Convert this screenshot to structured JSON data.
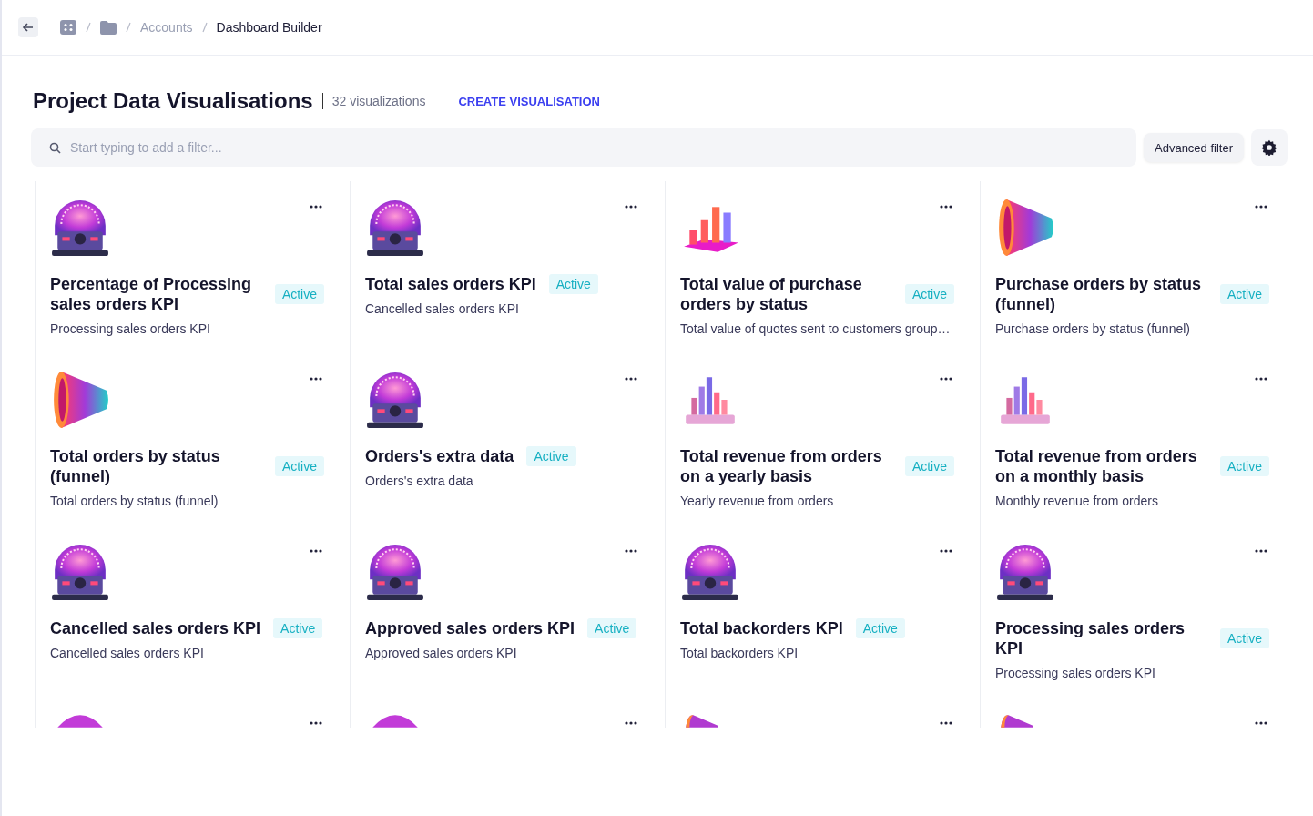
{
  "breadcrumb": {
    "items": [
      "Accounts",
      "Dashboard Builder"
    ]
  },
  "header": {
    "title": "Project Data Visualisations",
    "count": "32 visualizations",
    "create_link": "CREATE VISUALISATION"
  },
  "search": {
    "placeholder": "Start typing to add a filter...",
    "advanced_filter": "Advanced filter"
  },
  "cards": [
    {
      "kind": "gauge",
      "title": "Percentage of Processing sales orders KPI",
      "status": "Active",
      "description": "Processing sales orders KPI"
    },
    {
      "kind": "gauge",
      "title": "Total sales orders KPI",
      "status": "Active",
      "description": "Cancelled sales orders KPI"
    },
    {
      "kind": "bars",
      "title": "Total value of purchase orders by status",
      "status": "Active",
      "description": "Total value of quotes sent to customers group…"
    },
    {
      "kind": "funnel",
      "title": "Purchase orders by status (funnel)",
      "status": "Active",
      "description": "Purchase orders by status (funnel)"
    },
    {
      "kind": "funnel",
      "title": "Total orders by status (funnel)",
      "status": "Active",
      "description": "Total orders by status (funnel)"
    },
    {
      "kind": "gauge",
      "title": "Orders's extra data",
      "status": "Active",
      "description": "Orders's extra data"
    },
    {
      "kind": "histogram",
      "title": "Total revenue from orders on a yearly basis",
      "status": "Active",
      "description": "Yearly revenue from orders"
    },
    {
      "kind": "histogram",
      "title": "Total revenue from orders on a monthly basis",
      "status": "Active",
      "description": "Monthly revenue from orders"
    },
    {
      "kind": "gauge",
      "title": "Cancelled sales orders KPI",
      "status": "Active",
      "description": "Cancelled sales orders KPI"
    },
    {
      "kind": "gauge",
      "title": "Approved sales orders KPI",
      "status": "Active",
      "description": "Approved sales orders KPI"
    },
    {
      "kind": "gauge",
      "title": "Total backorders KPI",
      "status": "Active",
      "description": "Total backorders KPI"
    },
    {
      "kind": "gauge",
      "title": "Processing sales orders KPI",
      "status": "Active",
      "description": "Processing sales orders KPI"
    },
    {
      "kind": "gauge"
    },
    {
      "kind": "gauge"
    },
    {
      "kind": "funnel"
    },
    {
      "kind": "funnel"
    }
  ]
}
